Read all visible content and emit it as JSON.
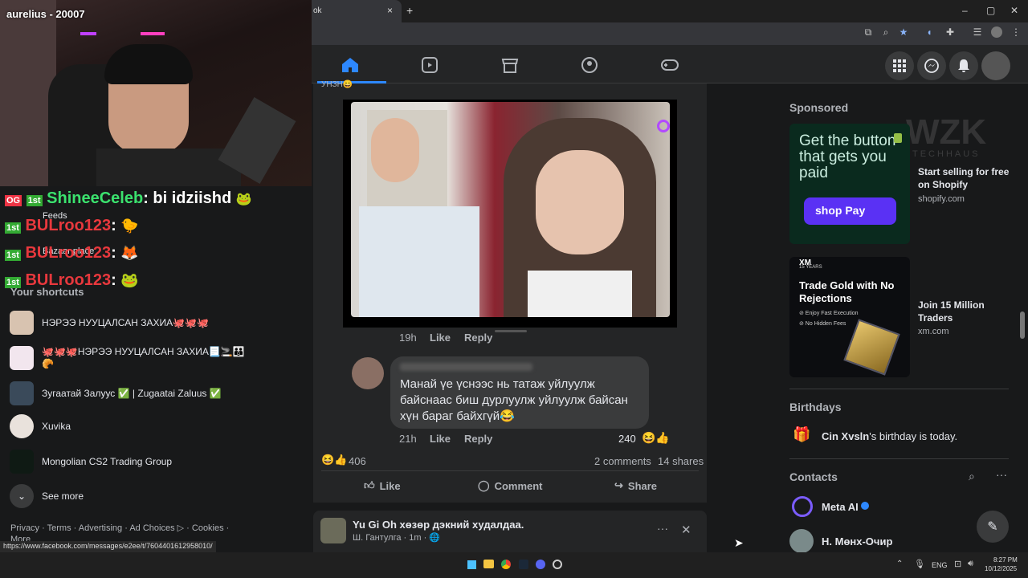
{
  "browser": {
    "tab_title": "ok",
    "tab_close": "×",
    "new_tab": "+",
    "win_min": "–",
    "win_max": "▢",
    "win_close": "✕"
  },
  "stream": {
    "streamer_label": "aurelius - 20007",
    "chat": [
      {
        "badges": "OG 1st",
        "user": "ShineeCeleb",
        "msg": "bi idziishd",
        "color": "#3be26e"
      },
      {
        "badges": "1st",
        "user": "BULroo123",
        "msg": ":",
        "color": "#e8383d"
      },
      {
        "badges": "1st",
        "user": "BULroo123",
        "msg": ":",
        "color": "#e8383d"
      },
      {
        "badges": "1st",
        "user": "BULroo123",
        "msg": ":",
        "color": "#e8383d"
      }
    ]
  },
  "sidebar": {
    "feeds_label": "Feeds",
    "item2_label": "Bazaar place",
    "shortcuts_title": "Your shortcuts",
    "shortcuts": [
      {
        "label": "НЭРЭЭ НУУЦАЛСАН ЗАХИА🐙🐙🐙"
      },
      {
        "label": "🐙🐙🐙НЭРЭЭ НУУЦАЛСАН ЗАХИА📃🚬👪🥐"
      },
      {
        "label": "Зугаатай Залуус ✅ | Zugaatai Zaluus ✅"
      },
      {
        "label": "Xuvika"
      },
      {
        "label": "Mongolian CS2 Trading Group"
      }
    ],
    "see_more": "See more",
    "footer": "Privacy · Terms · Advertising · Ad Choices ▷ · Cookies · More"
  },
  "feed": {
    "top_label": "УНЗН😄",
    "comment1_time": "19h",
    "comment1_like": "Like",
    "comment1_reply": "Reply",
    "comment2_text": "Манай үе үснээс нь татаж уйлуулж байснаас биш дурлуулж уйлуулж байсан хүн бараг байхгүй😂",
    "comment2_time": "21h",
    "comment2_like": "Like",
    "comment2_reply": "Reply",
    "comment2_count": "240",
    "reaction_count": "406",
    "comments": "2 comments",
    "shares": "14 shares",
    "like_btn": "Like",
    "comment_btn": "Comment",
    "share_btn": "Share",
    "post2_title": "Yu Gi Oh хөзөр дэкний худалдаа.",
    "post2_meta": "Ш. Гантулга · 1m · 🌐",
    "post2_more": "···",
    "post2_close": "✕"
  },
  "right": {
    "sponsored": "Sponsored",
    "ads": [
      {
        "title": "Start selling for free on Shopify",
        "domain": "shopify.com",
        "img_text": "Get the button that gets you paid",
        "badge": "shop Pay"
      },
      {
        "title": "Join 15 Million Traders",
        "domain": "xm.com",
        "img_text": "Trade Gold with No Rejections",
        "logo": "XM",
        "years": "15 YEARS",
        "bullet1": "⊘ Enjoy Fast Execution",
        "bullet2": "⊘ No Hidden Fees"
      }
    ],
    "birthdays_title": "Birthdays",
    "birthday_name": "Cin Xvsln",
    "birthday_text": "'s birthday is today.",
    "contacts_title": "Contacts",
    "contacts": [
      {
        "name": "Meta AI"
      },
      {
        "name": "Н. Мөнх-Очир"
      }
    ],
    "watermark": "WZK",
    "watermark_sub": "TECHHAUS"
  },
  "status_url": "https://www.facebook.com/messages/e2ee/t/7604401612958010/",
  "taskbar": {
    "lang": "ENG",
    "time": "8:27 PM",
    "date": "10/12/2025"
  },
  "colors": {
    "accent": "#2d88ff",
    "bg": "#18191a",
    "card": "#242526"
  }
}
